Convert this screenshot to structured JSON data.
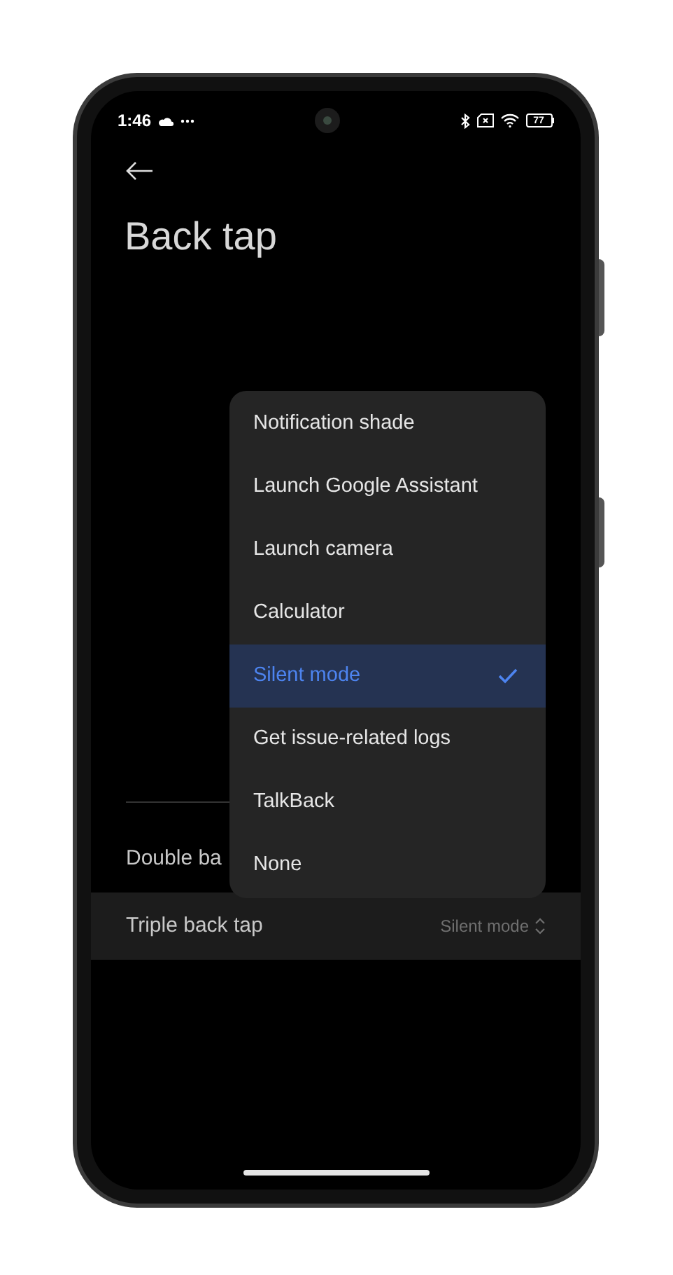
{
  "status_bar": {
    "time": "1:46",
    "battery": "77"
  },
  "header": {
    "title": "Back tap"
  },
  "settings": [
    {
      "label": "Double ba"
    },
    {
      "label": "Triple back tap",
      "value": "Silent mode",
      "highlighted": true
    }
  ],
  "menu": {
    "items": [
      {
        "label": "Notification shade",
        "selected": false
      },
      {
        "label": "Launch Google Assistant",
        "selected": false
      },
      {
        "label": "Launch camera",
        "selected": false
      },
      {
        "label": "Calculator",
        "selected": false
      },
      {
        "label": "Silent mode",
        "selected": true
      },
      {
        "label": "Get issue-related logs",
        "selected": false
      },
      {
        "label": "TalkBack",
        "selected": false
      },
      {
        "label": "None",
        "selected": false
      }
    ]
  }
}
